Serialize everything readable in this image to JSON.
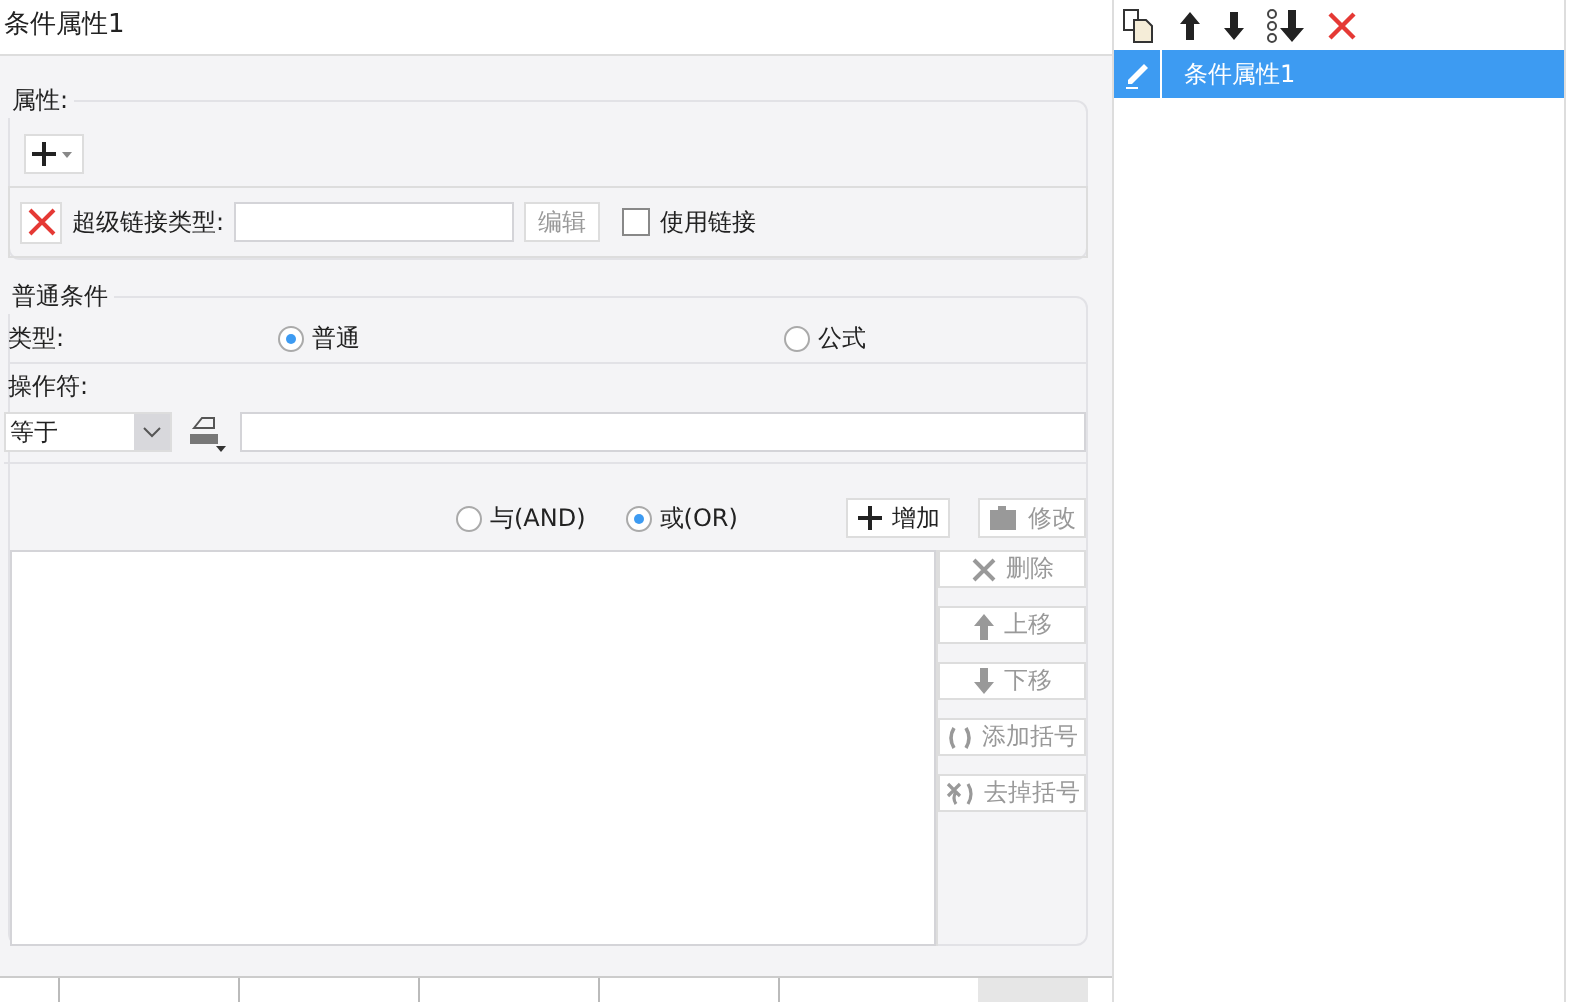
{
  "title": "条件属性1",
  "attributes": {
    "legend": "属性:",
    "hyperlink_label": "超级链接类型:",
    "edit_button": {
      "label": "编辑",
      "disabled": true
    },
    "use_link": {
      "label": "使用链接",
      "checked": false
    }
  },
  "condition": {
    "legend": "普通条件",
    "type_label": "类型:",
    "types": [
      {
        "label": "普通",
        "selected": true
      },
      {
        "label": "公式",
        "selected": false
      }
    ],
    "operator_label": "操作符:",
    "operator": "等于",
    "joins": [
      {
        "label": "与(AND)",
        "selected": false
      },
      {
        "label": "或(OR)",
        "selected": true
      }
    ],
    "top_buttons": [
      {
        "kind": "add",
        "label": "增加",
        "disabled": false
      },
      {
        "kind": "edit",
        "label": "修改",
        "disabled": true
      }
    ],
    "side_buttons": [
      {
        "kind": "delete",
        "label": "删除",
        "disabled": true
      },
      {
        "kind": "up",
        "label": "上移",
        "disabled": true
      },
      {
        "kind": "down",
        "label": "下移",
        "disabled": true
      },
      {
        "kind": "bracket",
        "label": "添加括号",
        "disabled": true
      },
      {
        "kind": "unbracket",
        "label": "去掉括号",
        "disabled": true
      }
    ]
  },
  "list": {
    "items": [
      {
        "label": "条件属性1",
        "selected": true
      }
    ]
  }
}
